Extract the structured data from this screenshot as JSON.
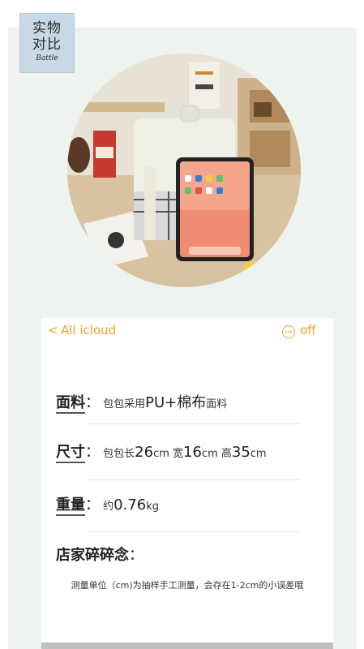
{
  "badge": {
    "line1": "实物",
    "line2": "对比",
    "line3": "Battle"
  },
  "note": {
    "back_symbol": "<",
    "folder": "All icloud",
    "off_label": "off",
    "fabric": {
      "label": "面料",
      "prefix": "包包采用",
      "highlight": "PU+棉布",
      "suffix": "面料"
    },
    "size": {
      "label": "尺寸",
      "parts": [
        "包包长",
        "26",
        "cm",
        " 宽",
        "16",
        "cm",
        " 高",
        "35",
        "cm"
      ]
    },
    "weight": {
      "label": "重量",
      "prefix": "约",
      "value": "0.76",
      "unit": "kg"
    },
    "store": {
      "label": "店家碎碎念"
    },
    "footnote": "测量单位（cm)为抽样手工测量，会存在1-2cm的小误差哦"
  },
  "colors": {
    "accent": "#e6a42a",
    "badge_bg": "#c8d8e6",
    "panel_bg": "#eef3ef"
  }
}
